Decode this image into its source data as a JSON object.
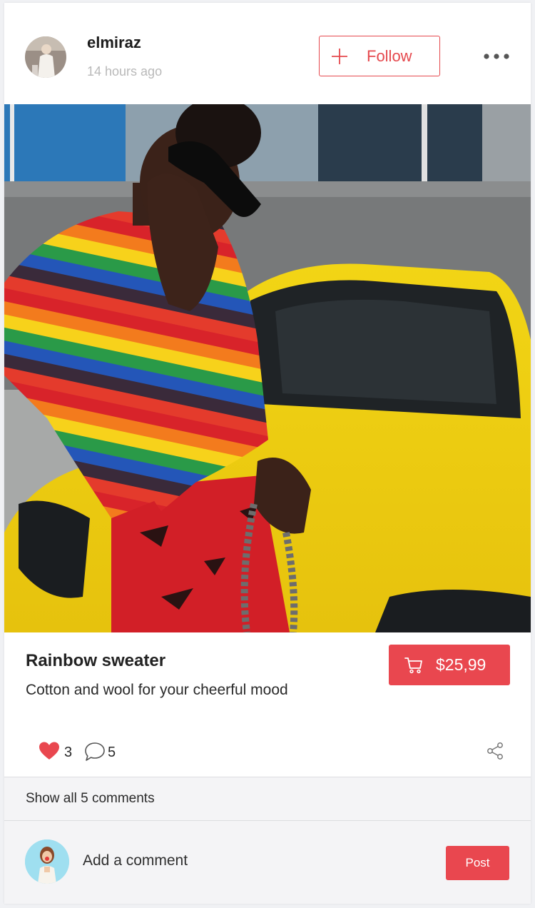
{
  "post": {
    "author": {
      "username": "elmiraz",
      "timestamp": "14 hours ago",
      "avatar_icon": "user-avatar"
    },
    "follow_label": "Follow",
    "more_icon": "more-horizontal-icon",
    "photo_alt": "woman in rainbow sweater by yellow car"
  },
  "product": {
    "title": "Rainbow sweater",
    "description": "Cotton and wool for your cheerful mood",
    "price": "$25,99",
    "cart_icon": "cart-icon"
  },
  "actions": {
    "likes": "3",
    "comments": "5",
    "like_icon": "heart-icon",
    "comment_icon": "comment-bubble-icon",
    "share_icon": "share-icon"
  },
  "comments": {
    "show_all_label": "Show all 5 comments",
    "input_placeholder": "Add a comment",
    "post_label": "Post"
  },
  "colors": {
    "accent": "#e9474f",
    "muted_text": "#b9b9b9",
    "panel_bg": "#f4f4f6"
  }
}
